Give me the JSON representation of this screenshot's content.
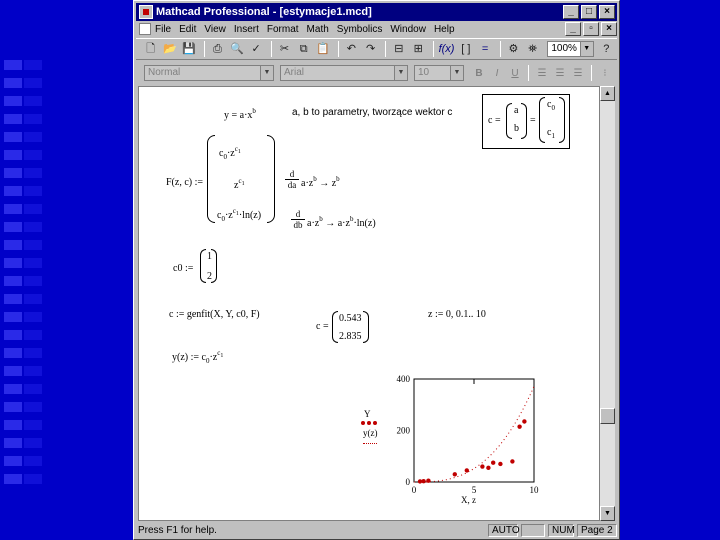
{
  "window": {
    "title": "Mathcad Professional - [estymacje1.mcd]"
  },
  "menu": [
    "File",
    "Edit",
    "View",
    "Insert",
    "Format",
    "Math",
    "Symbolics",
    "Window",
    "Help"
  ],
  "toolbar": {
    "zoom": "100%"
  },
  "formatbar": {
    "style": "Normal",
    "font": "Arial",
    "size": "10",
    "bold": "B",
    "italic": "I",
    "underline": "U"
  },
  "worksheet": {
    "model_def": "y = a·x",
    "model_exp": "b",
    "note": "a, b to parametry, tworzące wektor c",
    "c_vec_lhs": "c =",
    "c_vec_a": "a",
    "c_vec_b": "b",
    "c_vec_eq": "=",
    "c_vec_c0": "c",
    "c_vec_c0_sub": "0",
    "c_vec_c1": "c",
    "c_vec_c1_sub": "1",
    "F_lhs": "F(z, c) :=",
    "d_da": "d",
    "da": "da",
    "da_expr": "a·z",
    "da_arrow": "→ z",
    "d_db": "d",
    "db": "db",
    "db_expr": "a·z",
    "db_arrow": "→ a·z",
    "db_ln": "·ln(z)",
    "exp_b": "b",
    "c0_lhs": "c0 :=",
    "c0_v1": "1",
    "c0_v2": "2",
    "genfit": "c := genfit(X, Y, c0, F)",
    "c_res_lhs": "c =",
    "c_res_v1": "0.543",
    "c_res_v2": "2.835",
    "range": "z := 0, 0.1.. 10",
    "yfit": "y(z) := c",
    "yfit_sub": "0",
    "yfit_z": "·z",
    "yfit_exp": "c",
    "yfit_exp_sub": "1",
    "F_m1": "c",
    "F_m1_sub": "0",
    "F_m1_z": "·z",
    "F_m1_exp": "c",
    "F_m1_exp_sub": "1",
    "F_m2_z": "z",
    "F_m2_exp": "c",
    "F_m2_exp_sub": "1",
    "F_m3": "c",
    "F_m3_sub": "0",
    "F_m3_z": "·z",
    "F_m3_exp": "c",
    "F_m3_exp_sub": "1",
    "F_m3_ln": "·ln(z)"
  },
  "chart_data": {
    "type": "scatter",
    "x_ticks": [
      "0",
      "5",
      "10"
    ],
    "y_ticks": [
      "0",
      "200",
      "400"
    ],
    "xlabel": "X, z",
    "legend": [
      "Y",
      "y(z)"
    ],
    "xlim": [
      0,
      10
    ],
    "ylim": [
      0,
      400
    ],
    "series": [
      {
        "name": "Y",
        "style": "points",
        "color": "#c00000",
        "x": [
          0.5,
          0.8,
          1.2,
          3.4,
          4.4,
          5.7,
          6.2,
          6.6,
          7.2,
          8.2,
          8.8,
          9.2
        ],
        "y": [
          2,
          3,
          5,
          30,
          45,
          60,
          55,
          75,
          70,
          80,
          215,
          235
        ]
      },
      {
        "name": "y(z)",
        "style": "dotted-line",
        "color": "#c00000",
        "a": 0.543,
        "b": 2.835
      }
    ]
  },
  "status": {
    "help": "Press F1 for help.",
    "auto": "AUTO",
    "num": "NUM",
    "page": "Page 2"
  },
  "colors": {
    "titlebar": "#000080",
    "background": "#0000c8",
    "points": "#c00000"
  }
}
